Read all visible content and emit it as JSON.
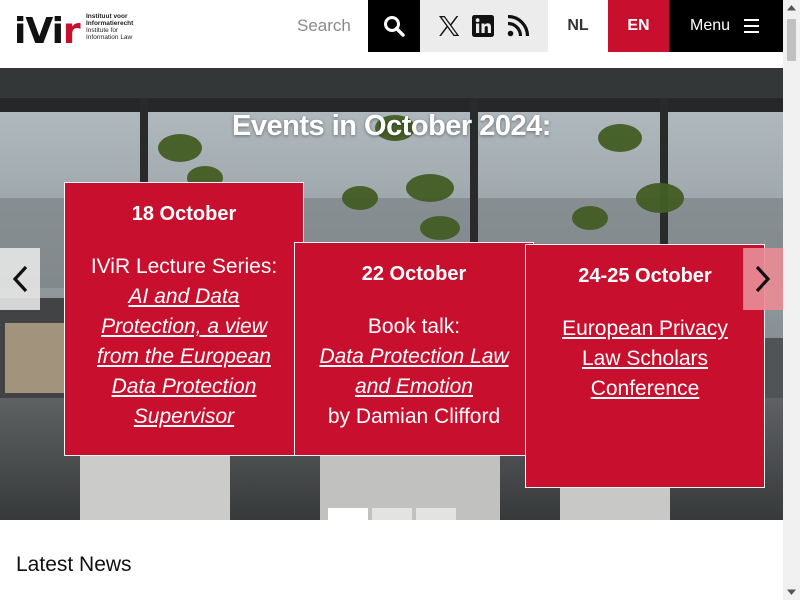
{
  "header": {
    "logo": {
      "mark": "ivir",
      "lines": [
        "Instituut voor",
        "Informatierecht",
        "Institute for",
        "Information Law"
      ]
    },
    "search_label": "Search",
    "lang_nl": "NL",
    "lang_en": "EN",
    "menu_label": "Menu"
  },
  "hero": {
    "title": "Events in October 2024:",
    "events": [
      {
        "date": "18 October",
        "intro": "IViR Lecture Series:",
        "link_lines": [
          "AI and Data",
          "Protection, a view",
          "from the European",
          "Data Protection",
          "Supervisor"
        ]
      },
      {
        "date": "22 October",
        "intro": "Book talk:",
        "link_lines": [
          "Data Protection Law",
          "and Emotion"
        ],
        "outro": "by Damian Clifford"
      },
      {
        "date": "24-25 October",
        "link_lines": [
          "European Privacy",
          "Law Scholars",
          "Conference"
        ]
      }
    ],
    "active_slide": 1,
    "slide_count": 3
  },
  "news": {
    "title": "Latest News"
  },
  "colors": {
    "accent": "#c8102e",
    "black": "#000000",
    "social_bg": "#ececec"
  },
  "icons": [
    "search-icon",
    "x-icon",
    "linkedin-icon",
    "rss-icon",
    "menu-icon",
    "chevron-left-icon",
    "chevron-right-icon"
  ]
}
